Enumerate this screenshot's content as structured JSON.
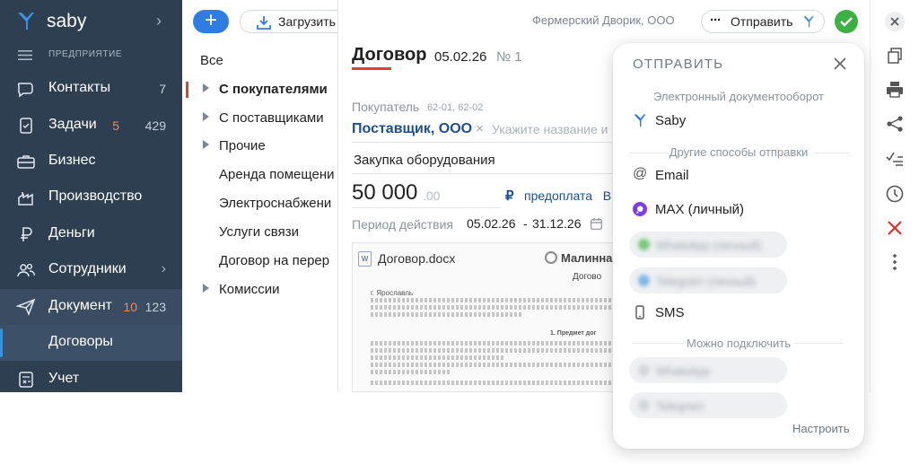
{
  "sidebar": {
    "logo_text": "saby",
    "section_label": "ПРЕДПРИЯТИЕ",
    "items": [
      {
        "label": "Контакты",
        "count": "7"
      },
      {
        "label": "Задачи",
        "count_hot": "5",
        "count": "429"
      },
      {
        "label": "Бизнес"
      },
      {
        "label": "Производство"
      },
      {
        "label": "Деньги"
      },
      {
        "label": "Сотрудники"
      },
      {
        "label": "Документ",
        "count_hot": "10",
        "count": "123"
      },
      {
        "label": "Договоры"
      },
      {
        "label": "Учет"
      }
    ]
  },
  "folders": {
    "upload_label": "Загрузить",
    "items": [
      "Все",
      "С покупателями",
      "С поставщиками",
      "Прочие",
      "Аренда помещени",
      "Электроснабжени",
      "Услуги связи",
      "Договор на перер",
      "Комиссии"
    ]
  },
  "topbar": {
    "company": "Фермерский Дворик, ООО",
    "send_label": "Отправить"
  },
  "document": {
    "title": "Договор",
    "date": "05.02.26",
    "number": "№ 1",
    "buyer_label": "Покупатель",
    "buyer_codes": "62-01, 62-02",
    "buyer_value": "Поставщик, ООО",
    "buyer_placeholder": "Укажите название и",
    "subject": "Закупка оборудования",
    "amount": "50 000",
    "amount_decimals": ".00",
    "currency": "₽",
    "payment": "предоплата",
    "payment_extra": "В",
    "period_label": "Период действия",
    "period_from": "05.02.26",
    "period_sep": "-",
    "period_to": "31.12.26",
    "file_name": "Договор.docx",
    "brand": "Малинна",
    "doc_heading": "Догово",
    "city": "г. Ярославль",
    "section": "1. Предмет дог"
  },
  "popup": {
    "title": "ОТПРАВИТЬ",
    "group_edo": "Электронный документооборот",
    "saby": "Saby",
    "group_other": "Другие способы отправки",
    "email": "Email",
    "max": "MAX (личный)",
    "blur1": "WhatsApp (личный)",
    "blur2": "Telegram (личный)",
    "sms": "SMS",
    "group_connect": "Можно подключить",
    "blur3": "WhatsApp",
    "blur4": "Telegram",
    "setup": "Настроить"
  },
  "colors": {
    "sidebar_bg": "#2f3f52",
    "accent_blue": "#2f7de1",
    "accent_red": "#d9472b",
    "ok_green": "#3cb043"
  }
}
